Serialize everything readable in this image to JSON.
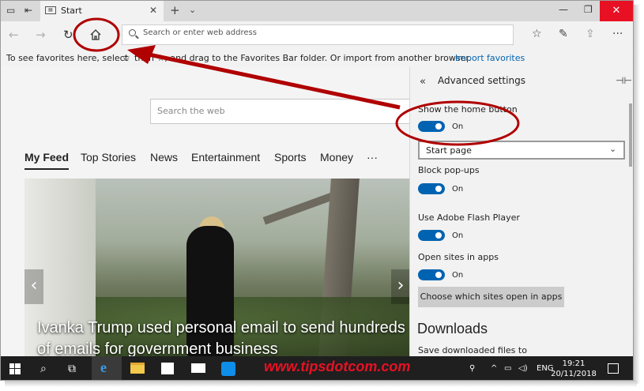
{
  "browser": {
    "tab_title": "Start",
    "address_placeholder": "Search or enter web address"
  },
  "favorites_bar": {
    "text_before": "To see favorites here, select",
    "text_after": "then ☆, and drag to the Favorites Bar folder. Or import from another browser.",
    "import_link": "Import favorites"
  },
  "page": {
    "search_placeholder": "Search the web",
    "feed_tabs": [
      "My Feed",
      "Top Stories",
      "News",
      "Entertainment",
      "Sports",
      "Money",
      "···"
    ],
    "active_tab": "My Feed",
    "headline": "Ivanka Trump used personal email to send hundreds of emails for government business"
  },
  "settings_panel": {
    "title": "Advanced settings",
    "show_home": {
      "label": "Show the home button",
      "state": "On"
    },
    "home_dropdown": "Start page",
    "block_popups": {
      "label": "Block pop-ups",
      "state": "On"
    },
    "flash": {
      "label": "Use Adobe Flash Player",
      "state": "On"
    },
    "open_in_apps": {
      "label": "Open sites in apps",
      "state": "On"
    },
    "choose_button": "Choose which sites open in apps",
    "downloads_heading": "Downloads",
    "downloads_label": "Save downloaded files to"
  },
  "taskbar": {
    "watermark": "www.tipsdotcom.com",
    "language": "ENG",
    "time": "19:21",
    "date": "20/11/2018"
  },
  "colors": {
    "accent": "#0063b1",
    "annotation_red": "#b00000",
    "close_red": "#e81123"
  }
}
